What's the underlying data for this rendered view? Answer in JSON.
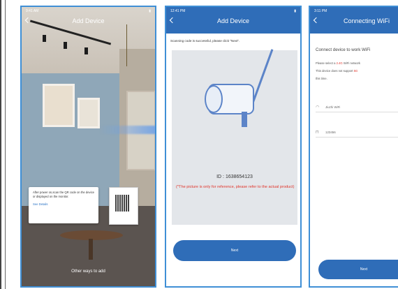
{
  "phone1": {
    "status_time": "9:41 AM",
    "title": "Add Device",
    "tooltip_text": "After power on,scan the QR code on the device or displayed on the monitor.",
    "tooltip_link": "See Details",
    "bottom_text": "Other ways to add"
  },
  "phone2": {
    "status_time": "12:41 PM",
    "title": "Add Device",
    "message": "Scanning code is successful, please click \"Next\".",
    "device_id": "ID : 1638654123",
    "warning": "(*The picture is only for reference, please refer to the actual product)",
    "button": "Next"
  },
  "phone3": {
    "status_time": "3:11 PM",
    "title": "Connecting WiFi",
    "heading": "Connect device to work WiFi",
    "line1_prefix": "Please select a ",
    "line1_red": "2.4G",
    "line1_suffix": " WiFi network",
    "line2_prefix": "This device does not support ",
    "line2_red": "5G",
    "line3": "this time.",
    "wifi_name": "Jiuzhi WiFi",
    "password": "123456",
    "button": "Next"
  },
  "colors": {
    "accent": "#2f6db8",
    "border": "#3f8fd6",
    "warning": "#e0352b"
  },
  "icons": [
    "chevron-left-icon",
    "wifi-icon",
    "lock-icon",
    "camera-icon",
    "qr-code-icon"
  ]
}
